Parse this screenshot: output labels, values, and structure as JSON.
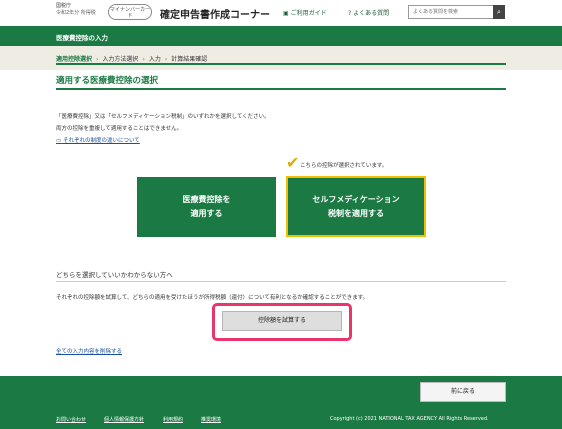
{
  "header": {
    "agency_line1": "国税庁",
    "agency_line2": "令和2年分",
    "agency_line3": "所得税",
    "mynumber_label": "マイナンバーカード",
    "site_title": "確定申告書作成コーナー",
    "guide_link": "ご利用ガイド",
    "faq_link": "よくある質問",
    "search_placeholder": "よくある質問を検索"
  },
  "navbar": {
    "section_title": "医療費控除の入力"
  },
  "breadcrumb": {
    "steps": [
      "適用控除選択",
      "入力方法選択",
      "入力",
      "計算結果確認"
    ]
  },
  "main": {
    "page_title": "適用する医療費控除の選択",
    "description_line1": "「医療費控除」又は「セルフメディケーション税制」のいずれかを選択してください。",
    "description_line2": "両方の控除を重複して適用することはできません。",
    "difference_link": "それぞれの制度の違いについて",
    "selected_note": "こちらの控除が選択されています。",
    "option_medical_line1": "医療費控除を",
    "option_medical_line2": "適用する",
    "option_self_line1": "セルフメディケーション",
    "option_self_line2": "税制を適用する",
    "unsure_heading": "どちらを選択していいかわからない方へ",
    "unsure_text": "それぞれの控除額を試算して、どちらの適用を受けたほうが所得税額（還付）について有利となるか確認することができます。",
    "calc_button": "控除額を試算する",
    "clear_link": "全ての入力内容を削除する"
  },
  "footer": {
    "back_button": "前に戻る",
    "links": [
      "お問い合わせ",
      "個人情報保護方針",
      "利用規約",
      "推奨環境"
    ],
    "copyright": "Copyright (c) 2021 NATIONAL TAX AGENCY All Rights Reserved."
  },
  "colors": {
    "brand_green": "#1b7a44",
    "selected_border": "#f0c000",
    "highlight": "#e8356b"
  }
}
